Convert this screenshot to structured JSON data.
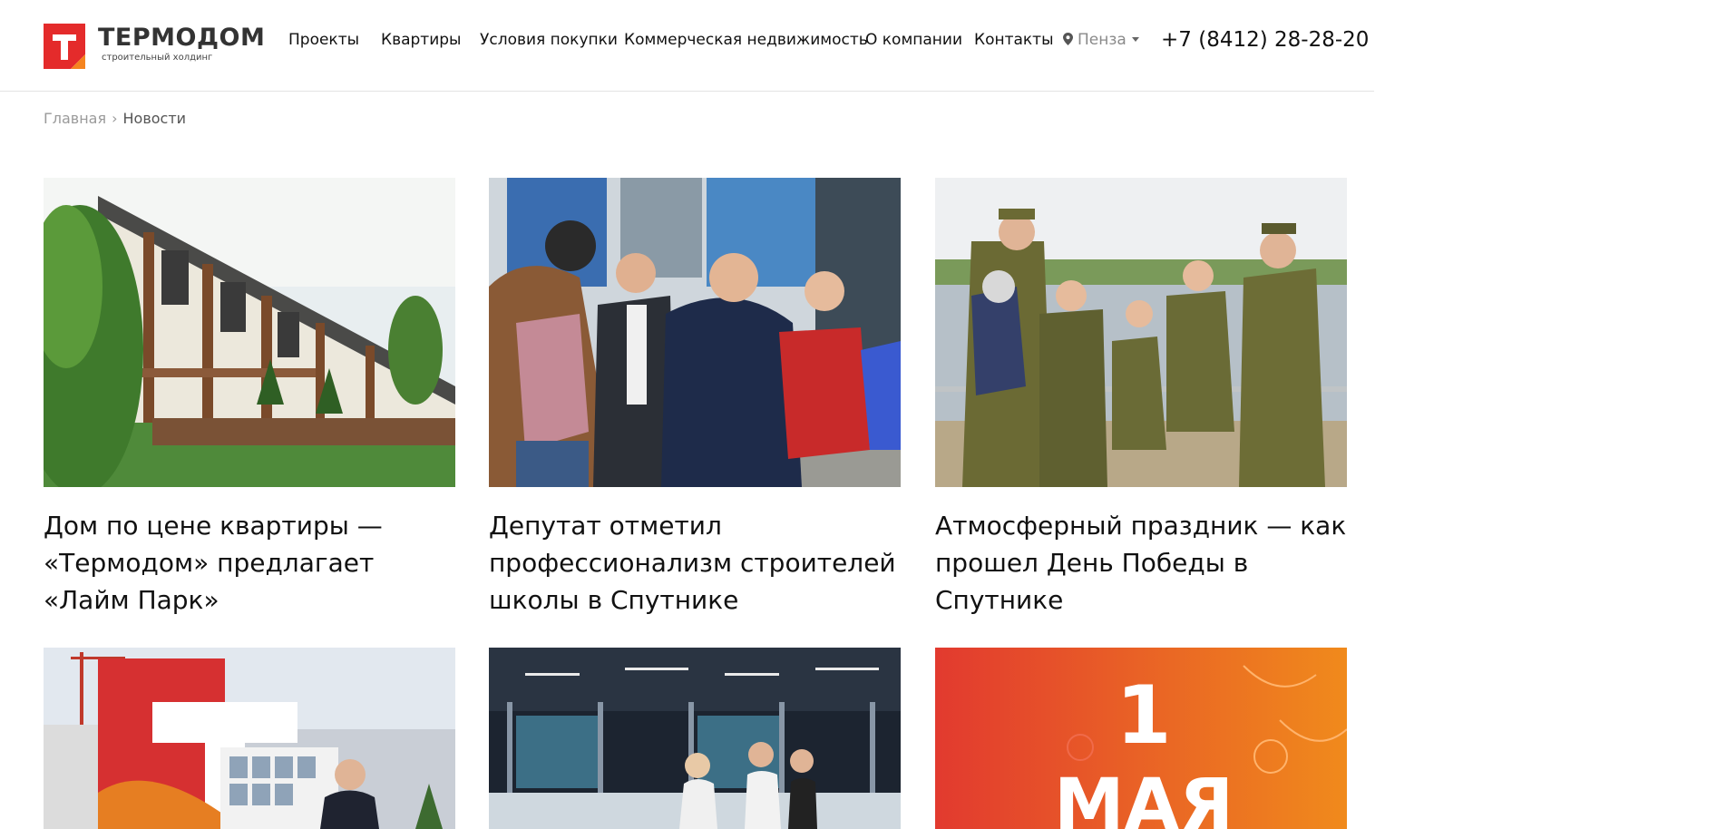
{
  "header": {
    "logo": {
      "name": "ТЕРМОДОМ",
      "subtitle": "строительный холдинг",
      "colors": {
        "red": "#e42b2b",
        "orange": "#f5841f"
      }
    },
    "nav": [
      {
        "label": "Проекты"
      },
      {
        "label": "Квартиры"
      },
      {
        "label": "Условия покупки"
      },
      {
        "label": "Коммерческая недвижимость"
      },
      {
        "label": "О компании"
      },
      {
        "label": "Контакты"
      }
    ],
    "city": {
      "label": "Пенза",
      "icon": "location-pin-icon"
    },
    "phone": "+7 (8412) 28-28-20"
  },
  "breadcrumb": {
    "home": "Главная",
    "separator": "›",
    "current": "Новости"
  },
  "news": [
    {
      "title": "Дом по цене квартиры — «Термодом» предлагает «Лайм Парк»",
      "image": "townhouses-photo"
    },
    {
      "title": "Депутат отметил профессионализм строителей школы в Спутнике",
      "image": "officials-visit-photo"
    },
    {
      "title": "Атмосферный праздник — как прошел День Победы в Спутнике",
      "image": "victory-day-family-photo"
    },
    {
      "title": "",
      "image": "termodom-stand-interview-photo"
    },
    {
      "title": "",
      "image": "showroom-model-photo"
    },
    {
      "title": "",
      "image": "may-day-banner",
      "banner_text": [
        "1",
        "МАЯ"
      ]
    }
  ]
}
